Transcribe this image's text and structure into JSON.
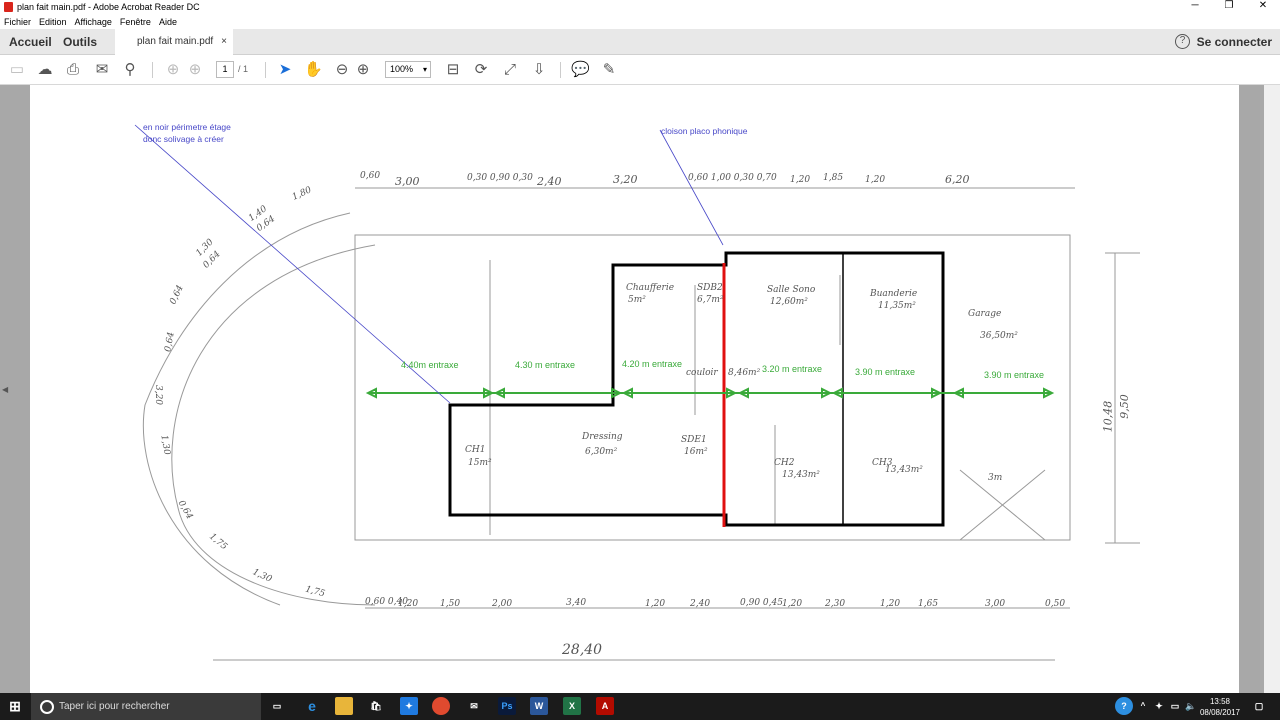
{
  "window": {
    "title": "plan fait main.pdf - Adobe Acrobat Reader DC",
    "minimize": "─",
    "maximize": "❐",
    "close": "✕"
  },
  "menu": [
    "Fichier",
    "Edition",
    "Affichage",
    "Fenêtre",
    "Aide"
  ],
  "tabs": {
    "home": "Accueil",
    "tools": "Outils",
    "document": "plan fait main.pdf",
    "close": "×"
  },
  "header": {
    "help": "?",
    "signin": "Se connecter"
  },
  "toolbar": {
    "page_current": "1",
    "page_total": "/ 1",
    "zoom": "100%"
  },
  "document": {
    "annotations": {
      "perimeter_note": "en noir périmetre étage donc solivage à créer",
      "partition_note": "cloison placo phonique"
    },
    "spacings": [
      "4.40m entraxe",
      "4.30 m entraxe",
      "4.20 m entraxe",
      "3.20 m entraxe",
      "3.90 m entraxe",
      "3.90 m entraxe"
    ],
    "rooms": [
      {
        "name": "Chaufferie",
        "area": "5m²"
      },
      {
        "name": "SDB2",
        "area": "6,7m²"
      },
      {
        "name": "Salle Sono",
        "area": "12,60m²"
      },
      {
        "name": "Buanderie",
        "area": "11,35m²"
      },
      {
        "name": "Garage",
        "area": "36,50m²"
      },
      {
        "name": "CH1",
        "area": "15m²"
      },
      {
        "name": "Dressing",
        "area": "6,30m²"
      },
      {
        "name": "SDE1",
        "area": "16m²"
      },
      {
        "name": "CH2",
        "area": "13,43m²"
      },
      {
        "name": "CH3",
        "area": "13,43m²"
      },
      {
        "name": "couloir",
        "area": "8,46m²"
      },
      {
        "name": "3m",
        "area": ""
      }
    ],
    "dims_top": [
      "0,60",
      "3,00",
      "0,30 0,90 0,30",
      "2,40",
      "3,20",
      "0,60 1,00 0,30 0,70",
      "1,20",
      "1,85",
      "1,20",
      "6,20"
    ],
    "dims_bottom": [
      "0,60 0,40",
      "1,20",
      "1,50",
      "2,00",
      "3,40",
      "1,20",
      "2,40",
      "0,90 0,45",
      "1,20",
      "2,30",
      "1,20",
      "1,65",
      "3,00",
      "0,50"
    ],
    "dims_total": "28,40",
    "dims_right": [
      "10,48",
      "9,50"
    ],
    "dims_arc": [
      "1,80",
      "1,40",
      "0,64",
      "1,30",
      "0,64",
      "0,64",
      "0,64",
      "3,20",
      "1,30",
      "0,64",
      "1,75",
      "1,30",
      "1,75"
    ]
  },
  "taskbar": {
    "search_placeholder": "Taper ici pour rechercher",
    "time": "13:58",
    "date": "08/08/2017"
  }
}
